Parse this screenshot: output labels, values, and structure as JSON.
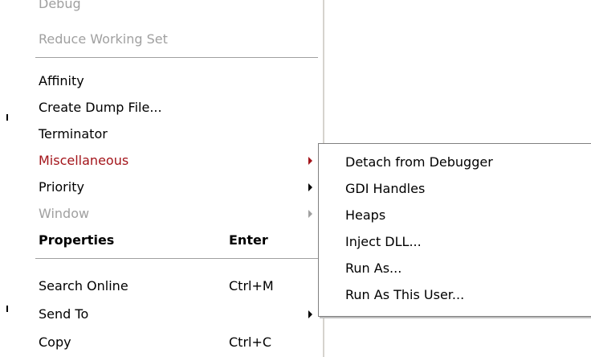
{
  "background": {
    "partial_text": ""
  },
  "menu": {
    "items": [
      {
        "label": "Debug",
        "shortcut": "",
        "state": "disabled",
        "submenu": false
      },
      {
        "label": "Reduce Working Set",
        "shortcut": "",
        "state": "disabled",
        "submenu": false
      },
      {
        "label": "Affinity",
        "shortcut": "",
        "state": "normal",
        "submenu": false
      },
      {
        "label": "Create Dump File...",
        "shortcut": "",
        "state": "normal",
        "submenu": false
      },
      {
        "label": "Terminator",
        "shortcut": "",
        "state": "normal",
        "submenu": false
      },
      {
        "label": "Miscellaneous",
        "shortcut": "",
        "state": "highlighted",
        "submenu": true
      },
      {
        "label": "Priority",
        "shortcut": "",
        "state": "normal",
        "submenu": true
      },
      {
        "label": "Window",
        "shortcut": "",
        "state": "disabled",
        "submenu": true
      },
      {
        "label": "Properties",
        "shortcut": "Enter",
        "state": "bold",
        "submenu": false
      },
      {
        "label": "Search Online",
        "shortcut": "Ctrl+M",
        "state": "normal",
        "submenu": false
      },
      {
        "label": "Send To",
        "shortcut": "",
        "state": "normal",
        "submenu": true
      },
      {
        "label": "Copy",
        "shortcut": "Ctrl+C",
        "state": "normal",
        "submenu": false
      }
    ]
  },
  "submenu": {
    "parent": "Miscellaneous",
    "items": [
      {
        "label": "Detach from Debugger"
      },
      {
        "label": "GDI Handles"
      },
      {
        "label": "Heaps"
      },
      {
        "label": "Inject DLL..."
      },
      {
        "label": "Run As..."
      },
      {
        "label": "Run As This User..."
      }
    ]
  },
  "colors": {
    "highlight_text": "#a3141a",
    "disabled_text": "#a0a0a0",
    "separator": "#a0a0a0"
  },
  "icons": {
    "submenu_arrow": "chevron-right-icon"
  }
}
